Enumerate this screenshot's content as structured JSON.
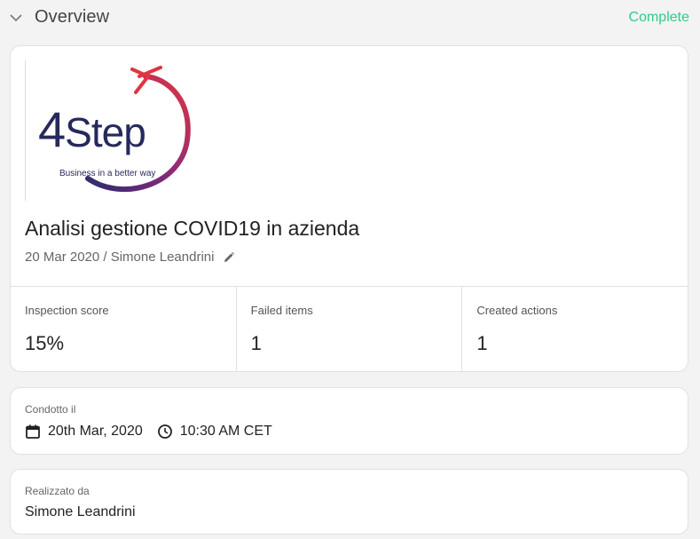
{
  "section": {
    "title": "Overview",
    "status": "Complete",
    "status_color": "#2ecc8a",
    "toggle_icon": "chevron-down-icon"
  },
  "logo": {
    "brand_number": "4",
    "brand_word": "Step",
    "tagline": "Business in a better way"
  },
  "audit": {
    "title": "Analisi gestione COVID19 in azienda",
    "meta": "20 Mar 2020 / Simone Leandrini",
    "edit_icon": "pencil-icon"
  },
  "stats": [
    {
      "label": "Inspection score",
      "value": "15%"
    },
    {
      "label": "Failed items",
      "value": "1"
    },
    {
      "label": "Created actions",
      "value": "1"
    }
  ],
  "conducted": {
    "label": "Condotto il",
    "date": "20th Mar, 2020",
    "date_icon": "calendar-icon",
    "time": "10:30 AM CET",
    "time_icon": "clock-icon"
  },
  "prepared": {
    "label": "Realizzato da",
    "name": "Simone Leandrini"
  }
}
